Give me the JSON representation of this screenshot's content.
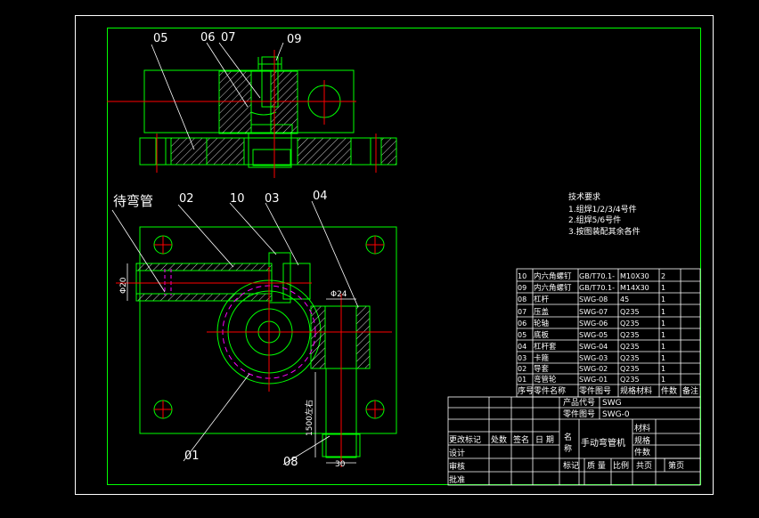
{
  "part_labels": {
    "p05": "05",
    "p06": "06",
    "p07": "07",
    "p09": "09",
    "daiwanguan": "待弯管",
    "p02": "02",
    "p10": "10",
    "p03": "03",
    "p04": "04",
    "p01": "01",
    "p08": "08"
  },
  "dimensions": {
    "d20": "Φ20",
    "d24": "Φ24",
    "d1500": "1500左右",
    "d30": "30"
  },
  "tech_notes": {
    "title": "技术要求",
    "lines": [
      "1.组焊1/2/3/4号件",
      "2.组焊5/6号件",
      "3.按图装配其余各件"
    ]
  },
  "bom": {
    "rows": [
      [
        "10",
        "内六角螺钉",
        "GB/T70.1-",
        "M10X30",
        "2",
        ""
      ],
      [
        "09",
        "内六角螺钉",
        "GB/T70.1-",
        "M14X30",
        "1",
        ""
      ],
      [
        "08",
        "杠杆",
        "SWG-08",
        "45",
        "1",
        ""
      ],
      [
        "07",
        "压盖",
        "SWG-07",
        "Q235",
        "1",
        ""
      ],
      [
        "06",
        "轮轴",
        "SWG-06",
        "Q235",
        "1",
        ""
      ],
      [
        "05",
        "底板",
        "SWG-05",
        "Q235",
        "1",
        ""
      ],
      [
        "04",
        "杠杆套",
        "SWG-04",
        "Q235",
        "1",
        ""
      ],
      [
        "03",
        "卡箍",
        "SWG-03",
        "Q235",
        "1",
        ""
      ],
      [
        "02",
        "导套",
        "SWG-02",
        "Q235",
        "1",
        ""
      ],
      [
        "01",
        "弯管轮",
        "SWG-01",
        "Q235",
        "1",
        ""
      ]
    ],
    "header": [
      "序号",
      "零件名称",
      "零件图号",
      "规格材料",
      "件数",
      "备注"
    ]
  },
  "title_block": {
    "product_code_label": "产品代号",
    "product_code": "SWG",
    "part_no_label": "零件图号",
    "part_no": "SWG-0",
    "rev_labels": [
      "更改标记",
      "处数",
      "签名",
      "日 期"
    ],
    "name_label_1": "名",
    "name_label_2": "称",
    "name": "手动弯管机",
    "material_label": "材料",
    "spec_label": "规格",
    "qty_label": "件数",
    "design": "设计",
    "review": "审核",
    "approve": "批准",
    "mark_label": "标记",
    "weight_label": "质 量",
    "scale_label": "比例",
    "total_pages": "共页",
    "page": "第页"
  },
  "colors": {
    "frame": "#00ff00",
    "outline": "#ffffff",
    "center": "#ff0000",
    "hatch": "#ffffff",
    "hidden": "#ff00ff",
    "text": "#ffffff"
  }
}
